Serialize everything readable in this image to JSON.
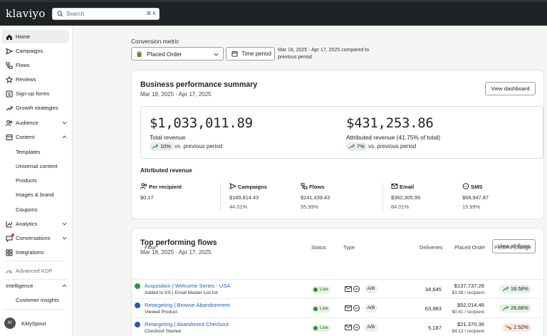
{
  "topbar": {
    "logo": "klaviyo",
    "search_placeholder": "Search",
    "search_shortcut": "⌘ K"
  },
  "sidebar": {
    "items": [
      {
        "label": "Home",
        "icon": "home-icon",
        "active": true
      },
      {
        "label": "Campaigns",
        "icon": "send-icon"
      },
      {
        "label": "Flows",
        "icon": "flow-icon"
      },
      {
        "label": "Reviews",
        "icon": "star-icon"
      },
      {
        "label": "Sign-up forms",
        "icon": "form-icon"
      },
      {
        "label": "Growth strategies",
        "icon": "trend-icon"
      },
      {
        "label": "Audience",
        "icon": "people-icon",
        "chevron": "down"
      },
      {
        "label": "Content",
        "icon": "content-icon",
        "chevron": "up"
      },
      {
        "label": "Templates"
      },
      {
        "label": "Universal content"
      },
      {
        "label": "Products"
      },
      {
        "label": "Images & brand"
      },
      {
        "label": "Coupons"
      },
      {
        "label": "Analytics",
        "icon": "analytics-icon",
        "chevron": "down"
      },
      {
        "label": "Conversations",
        "icon": "chat-icon",
        "chevron": "down"
      },
      {
        "label": "Integrations",
        "icon": "grid-icon"
      },
      {
        "label": "Advanced KDP",
        "icon": "kdp-icon"
      },
      {
        "label": "Intelligence",
        "chevron": "up"
      },
      {
        "label": "Customer insights"
      }
    ],
    "user": {
      "initials": "KI",
      "name": "KittySpout"
    }
  },
  "controls": {
    "metric_label": "Conversion metric",
    "metric_value": "Placed Order",
    "time_button": "Time period",
    "period_note": "Mar 18, 2025 - Apr 17, 2025 compared to previous period"
  },
  "summary": {
    "title": "Business performance summary",
    "range": "Mar 18, 2025 - Apr 17, 2025",
    "button": "View dashboard",
    "total_value": "$1,033,011.89",
    "total_label": "Total revenue",
    "total_change": "10%",
    "attributed_value": "$431,253.86",
    "attributed_label": "Attributed revenue (41.75% of total)",
    "attributed_change": "7%",
    "vs_text": "vs. previous period",
    "attr_title": "Attributed revenue",
    "columns": [
      {
        "label": "Per recipient",
        "icon": "people-icon",
        "value": "$0.17",
        "pct": ""
      },
      {
        "label": "Campaigns",
        "icon": "send-icon",
        "value": "$189,814.43",
        "pct": "44.01%"
      },
      {
        "label": "Flows",
        "icon": "flow-icon",
        "value": "$241,439.43",
        "pct": "55.99%"
      },
      {
        "label": "Email",
        "icon": "email-icon",
        "value": "$362,305.99",
        "pct": "84.01%"
      },
      {
        "label": "SMS",
        "icon": "sms-icon",
        "value": "$68,947.87",
        "pct": "15.99%"
      }
    ]
  },
  "flows": {
    "title": "Top performing flows",
    "range": "Mar 18, 2025 - Apr 17, 2025",
    "button": "View all flows",
    "headers": [
      "Flow",
      "Status",
      "Type",
      "Deliveries",
      "Placed Order",
      "Percent change"
    ],
    "rows": [
      {
        "name": "Acquisition | Welcome Series - USA",
        "sub": "Added to KS | Email Master List list",
        "dot_color": "#2f9b3a",
        "status": "Live",
        "ab": "A/B",
        "deliveries": "34,645",
        "placed": "$137,737.28",
        "per_recipient": "$3.98 / recipient",
        "change": "18.58%",
        "direction": "up"
      },
      {
        "name": "Retargeting | Browse Abandonment",
        "sub": "Viewed Product",
        "dot_color": "#2557b8",
        "status": "Live",
        "ab": "A/B",
        "deliveries": "63,983",
        "placed": "$52,014.46",
        "per_recipient": "$0.81 / recipient",
        "change": "28.66%",
        "direction": "up"
      },
      {
        "name": "Retargeting | Abandoned Checkout",
        "sub": "Checkout Started",
        "dot_color": "#2557b8",
        "status": "Live",
        "ab": "A/B",
        "deliveries": "5,187",
        "placed": "$21,370.36",
        "per_recipient": "$4.12 / recipient",
        "change": "2.52%",
        "direction": "down"
      }
    ]
  },
  "colors": {
    "topbar": "#1f2326",
    "up_pill": "#e4f2e7",
    "down_pill": "#fbe6e4",
    "link": "#2462b4"
  }
}
